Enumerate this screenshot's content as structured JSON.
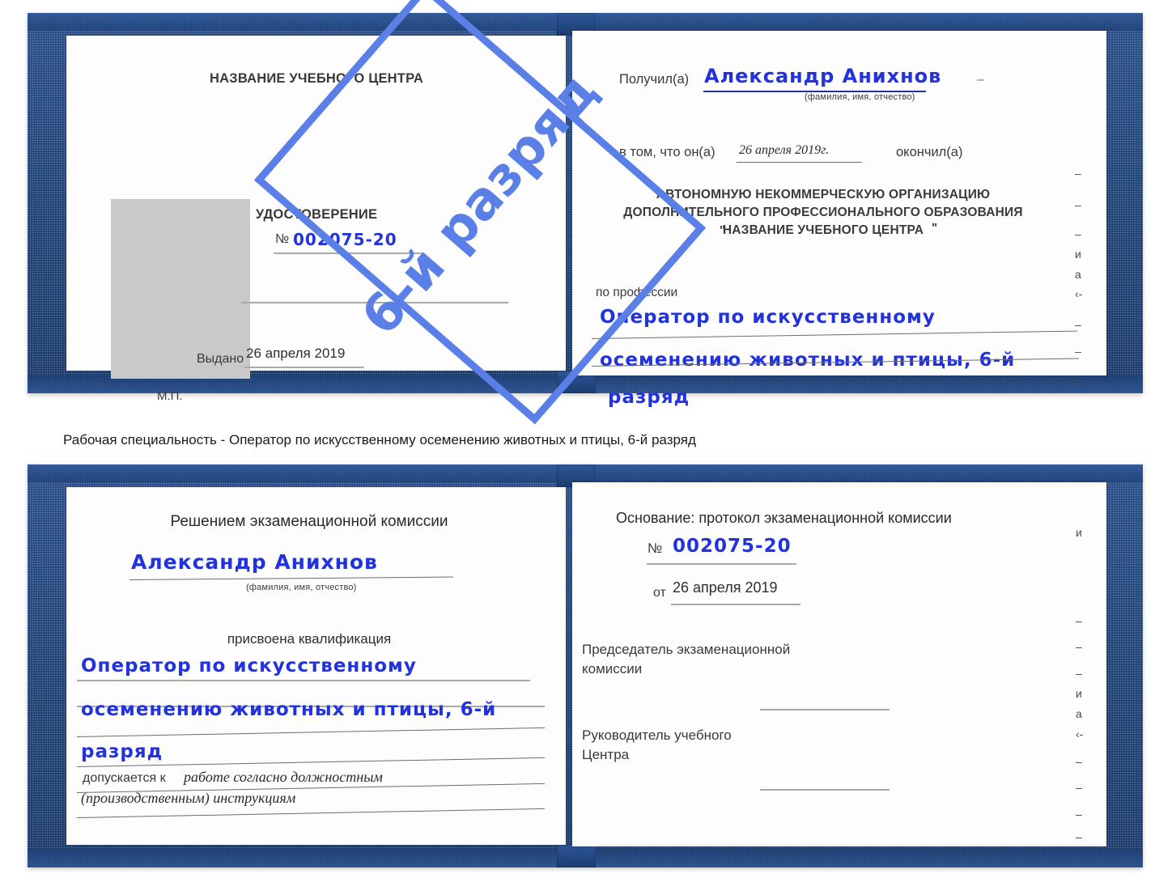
{
  "caption": {
    "text": "Рабочая специальность - Оператор по искусственному осеменению животных и птицы, 6-й разряд"
  },
  "watermark": {
    "label": "6-й разряд",
    "color": "#5a7fe6"
  },
  "colors": {
    "cover": "#21497f",
    "ink": "#2233dd",
    "print": "#3a3a3a",
    "rule": "#a9a9a9",
    "photo_placeholder": "#c9c9c9"
  },
  "certificate_front": {
    "left_page": {
      "center_name": "НАЗВАНИЕ УЧЕБНОГО ЦЕНТРА",
      "doc_type": "УДОСТОВЕРЕНИЕ",
      "number_symbol": "№",
      "number_value": "002075-20",
      "issued_label": "Выдано",
      "issued_value": "26 апреля 2019",
      "seal_label": "М.П."
    },
    "right_page": {
      "received_label": "Получил(а)",
      "received_value": "Александр Анихнов",
      "fio_hint": "(фамилия, имя, отчество)",
      "in_that_label": "в том, что он(а)",
      "completion_date": "26 апреля 2019г.",
      "finished_label": "окончил(а)",
      "org_line1": "АВТОНОМНУЮ НЕКОММЕРЧЕСКУЮ ОРГАНИЗАЦИЮ",
      "org_line2": "ДОПОЛНИТЕЛЬНОГО ПРОФЕССИОНАЛЬНОГО ОБРАЗОВАНИЯ",
      "org_quote_open": "\"",
      "org_line3": "НАЗВАНИЕ УЧЕБНОГО ЦЕНТРА",
      "org_quote_close": "\"",
      "profession_label": "по профессии",
      "profession_line1": "Оператор по искусственному",
      "profession_line2": "осеменению животных и птицы, 6-й",
      "profession_line3": "разряд"
    },
    "bleed_fragments": [
      "–",
      "–",
      "–",
      "и",
      "а",
      "‹-",
      "–",
      "–",
      "–"
    ]
  },
  "certificate_back": {
    "left_page": {
      "heading": "Решением экзаменационной комиссии",
      "name_value": "Александр Анихнов",
      "fio_hint": "(фамилия, имя, отчество)",
      "qualification_label": "присвоена квалификация",
      "qualification_line1": "Оператор по искусственному",
      "qualification_line2": "осеменению животных и птицы, 6-й",
      "qualification_line3": "разряд",
      "admitted_label": "допускается к",
      "admitted_value_line1": "работе согласно должностным",
      "admitted_value_line2": "(производственным) инструкциям"
    },
    "right_page": {
      "basis_label": "Основание: протокол экзаменационной комиссии",
      "number_symbol": "№",
      "number_value": "002075-20",
      "date_label": "от",
      "date_value": "26 апреля 2019",
      "chairman_line1": "Председатель экзаменационной",
      "chairman_line2": "комиссии",
      "director_line1": "Руководитель учебного",
      "director_line2": "Центра"
    },
    "bleed_fragments": [
      "и",
      "–",
      "–",
      "–",
      "и",
      "а",
      "‹-",
      "–",
      "–",
      "–",
      "–"
    ]
  }
}
